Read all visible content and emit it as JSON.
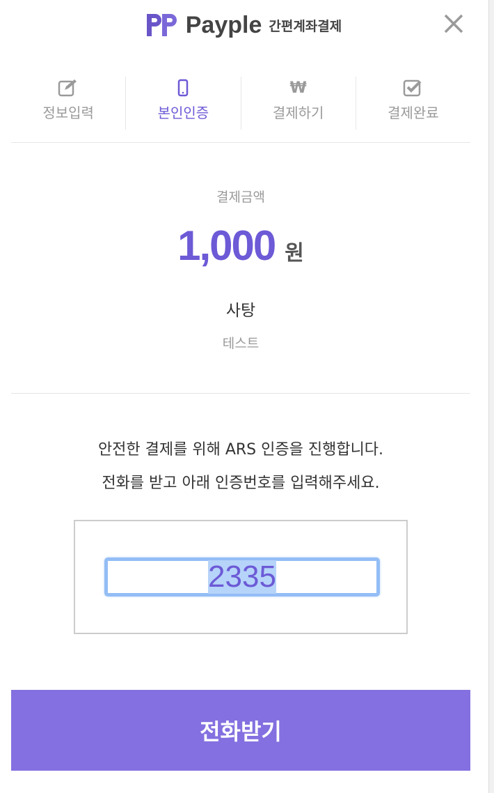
{
  "header": {
    "brand": "Payple",
    "subtitle": "간편계좌결제",
    "close_icon": "close-icon"
  },
  "steps": [
    {
      "label": "정보입력",
      "icon": "edit-icon",
      "active": false
    },
    {
      "label": "본인인증",
      "icon": "mobile-phone-icon",
      "active": true
    },
    {
      "label": "결제하기",
      "icon": "won-icon",
      "glyph": "₩",
      "active": false
    },
    {
      "label": "결제완료",
      "icon": "checkbox-icon",
      "active": false
    }
  ],
  "payment": {
    "amount_label": "결제금액",
    "amount": "1,000",
    "unit": "원",
    "product": "사탕",
    "store": "테스트"
  },
  "ars": {
    "line1": "안전한 결제를 위해 ARS 인증을 진행합니다.",
    "line2": "전화를 받고 아래 인증번호를 입력해주세요.",
    "code": "2335"
  },
  "button": {
    "label": "전화받기"
  },
  "colors": {
    "accent": "#6c5ad6",
    "button": "#8470e0",
    "inactive": "#9a9a9a"
  }
}
